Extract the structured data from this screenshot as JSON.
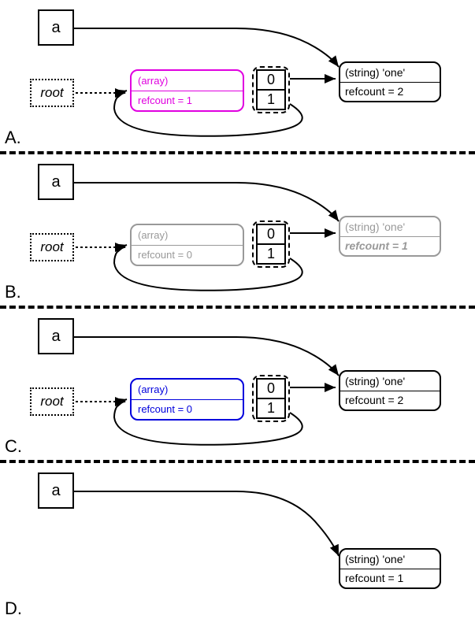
{
  "panels": [
    {
      "label": "A.",
      "a": "a",
      "root": "root",
      "array_type": "(array)",
      "array_refcount": "refcount = 1",
      "array_color": "#e000e0",
      "idx0": "0",
      "idx1": "1",
      "str_type": "(string) 'one'",
      "str_refcount": "refcount = 2",
      "str_faded": false,
      "show_root": true,
      "show_array": true,
      "show_idx": true
    },
    {
      "label": "B.",
      "a": "a",
      "root": "root",
      "array_type": "(array)",
      "array_refcount": "refcount = 0",
      "array_color": "#999999",
      "idx0": "0",
      "idx1": "1",
      "str_type": "(string) 'one'",
      "str_refcount": "refcount = 1",
      "str_faded": true,
      "show_root": true,
      "show_array": true,
      "show_idx": true
    },
    {
      "label": "C.",
      "a": "a",
      "root": "root",
      "array_type": "(array)",
      "array_refcount": "refcount = 0",
      "array_color": "#0000dd",
      "idx0": "0",
      "idx1": "1",
      "str_type": "(string) 'one'",
      "str_refcount": "refcount = 2",
      "str_faded": false,
      "show_root": true,
      "show_array": true,
      "show_idx": true
    },
    {
      "label": "D.",
      "a": "a",
      "root": "",
      "array_type": "",
      "array_refcount": "",
      "array_color": "",
      "idx0": "",
      "idx1": "",
      "str_type": "(string) 'one'",
      "str_refcount": "refcount = 1",
      "str_faded": false,
      "show_root": false,
      "show_array": false,
      "show_idx": false
    }
  ],
  "chart_data": {
    "type": "diagram",
    "description": "PHP garbage collection refcount diagram showing root buffer and zval references across four states A-D",
    "states": [
      {
        "id": "A",
        "array_refcount": 1,
        "string_refcount": 2,
        "array_highlighted": "magenta"
      },
      {
        "id": "B",
        "array_refcount": 0,
        "string_refcount": 1,
        "array_highlighted": "gray",
        "string_faded": true
      },
      {
        "id": "C",
        "array_refcount": 0,
        "string_refcount": 2,
        "array_highlighted": "blue"
      },
      {
        "id": "D",
        "string_refcount": 1,
        "array_removed": true
      }
    ]
  }
}
